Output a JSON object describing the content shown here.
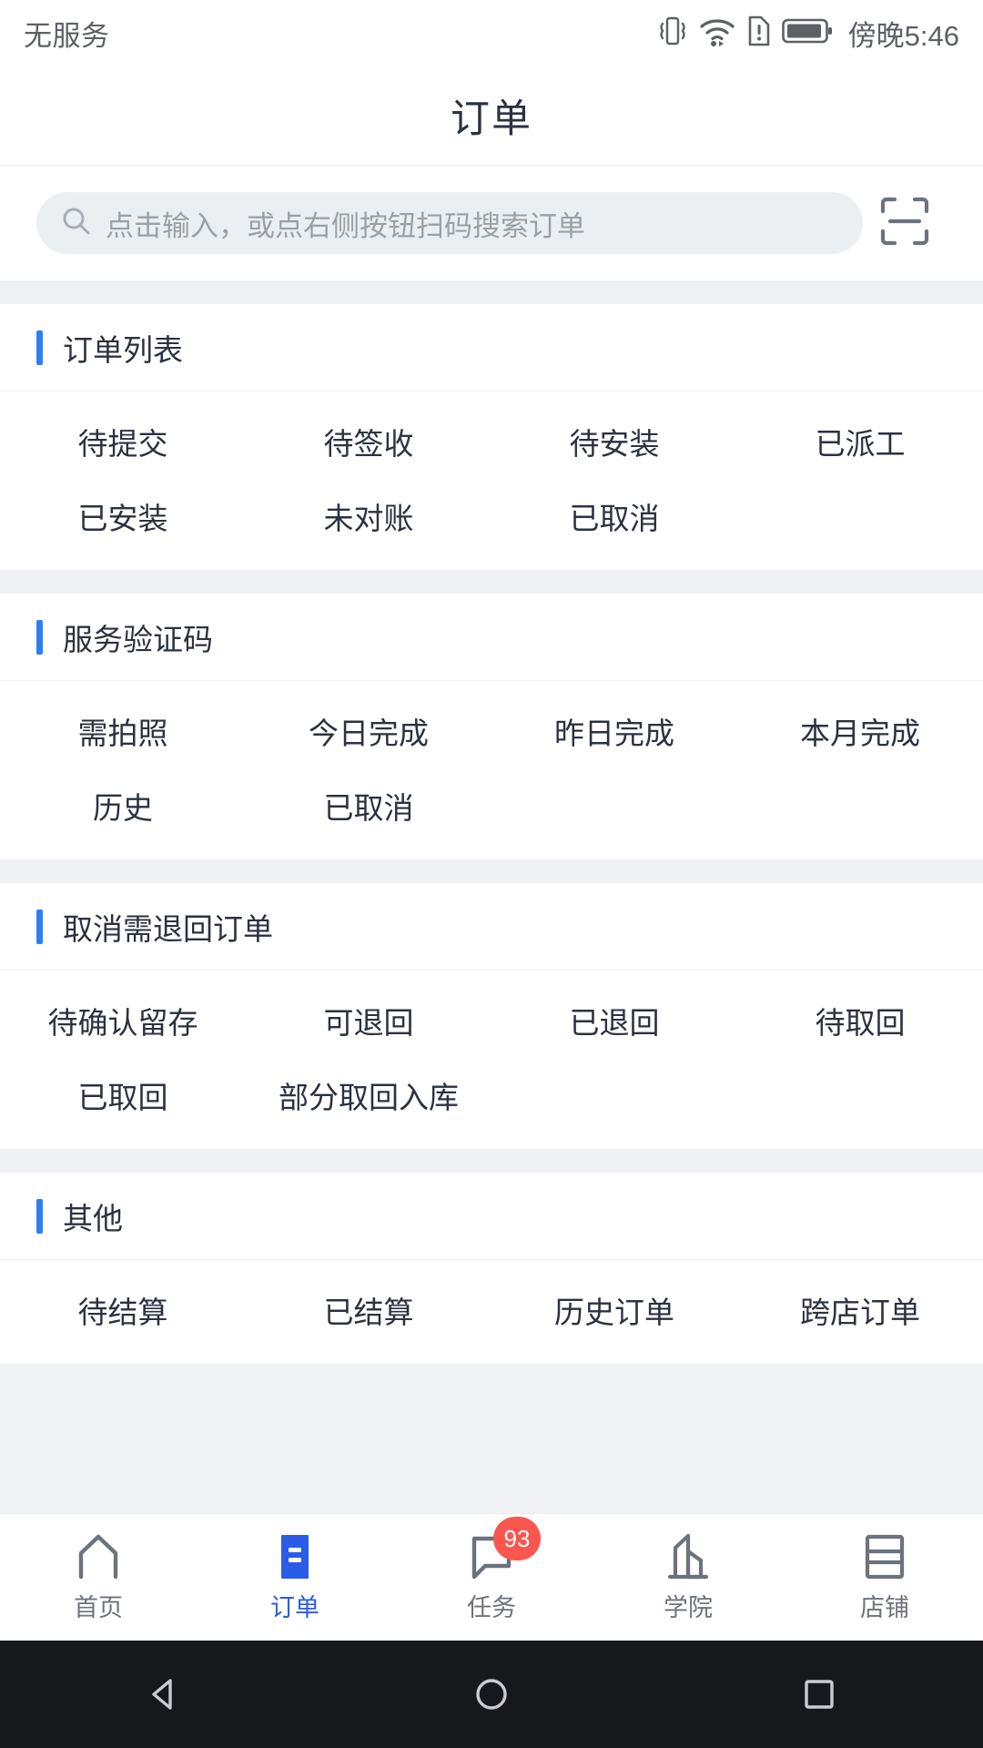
{
  "status_bar": {
    "carrier": "无服务",
    "time": "傍晚5:46",
    "icons": [
      "vibrate-icon",
      "wifi-icon",
      "sim-alert-icon",
      "battery-icon"
    ]
  },
  "header": {
    "title": "订单"
  },
  "search": {
    "placeholder": "点击输入，或点右侧按钮扫码搜索订单",
    "value": "",
    "search_icon": "search-icon",
    "scan_icon": "scan-code-icon"
  },
  "sections": [
    {
      "title": "订单列表",
      "items": [
        "待提交",
        "待签收",
        "待安装",
        "已派工",
        "已安装",
        "未对账",
        "已取消"
      ]
    },
    {
      "title": "服务验证码",
      "items": [
        "需拍照",
        "今日完成",
        "昨日完成",
        "本月完成",
        "历史",
        "已取消"
      ]
    },
    {
      "title": "取消需退回订单",
      "items": [
        "待确认留存",
        "可退回",
        "已退回",
        "待取回",
        "已取回",
        "部分取回入库"
      ]
    },
    {
      "title": "其他",
      "items": [
        "待结算",
        "已结算",
        "历史订单",
        "跨店订单"
      ]
    }
  ],
  "tabbar": {
    "tabs": [
      {
        "label": "首页",
        "icon": "home-icon",
        "active": false,
        "badge": ""
      },
      {
        "label": "订单",
        "icon": "order-list-icon",
        "active": true,
        "badge": ""
      },
      {
        "label": "任务",
        "icon": "task-chat-icon",
        "active": false,
        "badge": "93"
      },
      {
        "label": "学院",
        "icon": "academy-building-icon",
        "active": false,
        "badge": ""
      },
      {
        "label": "店铺",
        "icon": "shop-icon",
        "active": false,
        "badge": ""
      }
    ]
  },
  "nav_bar": {
    "back": "back-triangle-icon",
    "home": "home-circle-icon",
    "recents": "recents-square-icon"
  },
  "colors": {
    "accent": "#2b7ff0",
    "tab_active": "#2b5ce6",
    "badge": "#f9564f",
    "text": "#2b3240",
    "muted": "#9aa0a8",
    "band": "#eff0f4"
  }
}
